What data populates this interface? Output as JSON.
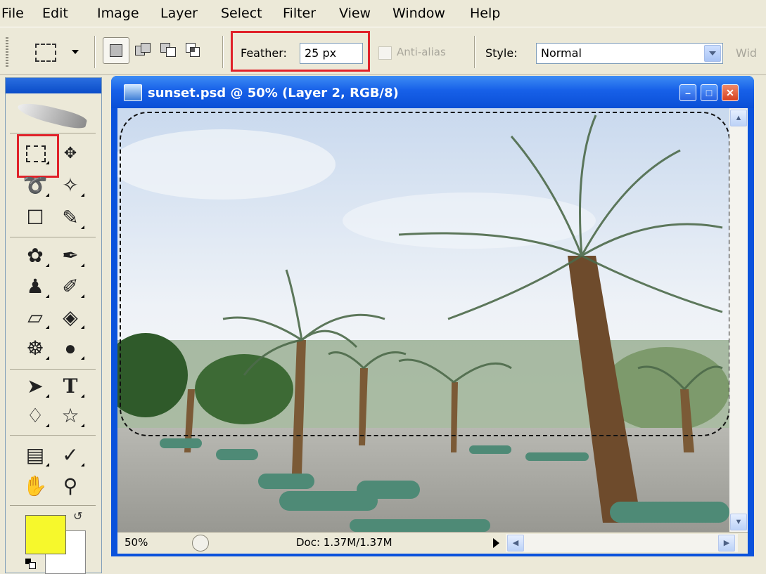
{
  "menu": [
    "File",
    "Edit",
    "Image",
    "Layer",
    "Select",
    "Filter",
    "View",
    "Window",
    "Help"
  ],
  "options": {
    "feather_label": "Feather:",
    "feather_value": "25 px",
    "antialias_label": "Anti-alias",
    "style_label": "Style:",
    "style_value": "Normal",
    "width_label": "Wid"
  },
  "document": {
    "title": "sunset.psd @ 50% (Layer 2, RGB/8)",
    "zoom": "50%",
    "doc_info": "Doc: 1.37M/1.37M"
  },
  "colors": {
    "foreground": "#f6f82c",
    "background": "#ffffff",
    "highlight": "#e0222a",
    "titlebar": "#0a52dc"
  },
  "icons": [
    "rect-marquee-icon",
    "move-icon",
    "lasso-icon",
    "magic-wand-icon",
    "crop-icon",
    "slice-icon",
    "healing-brush-icon",
    "brush-icon",
    "clone-stamp-icon",
    "history-brush-icon",
    "eraser-icon",
    "paint-bucket-icon",
    "blur-icon",
    "dodge-icon",
    "path-select-icon",
    "type-icon",
    "pen-icon",
    "custom-shape-icon",
    "notes-icon",
    "eyedropper-icon",
    "hand-icon",
    "zoom-icon"
  ]
}
